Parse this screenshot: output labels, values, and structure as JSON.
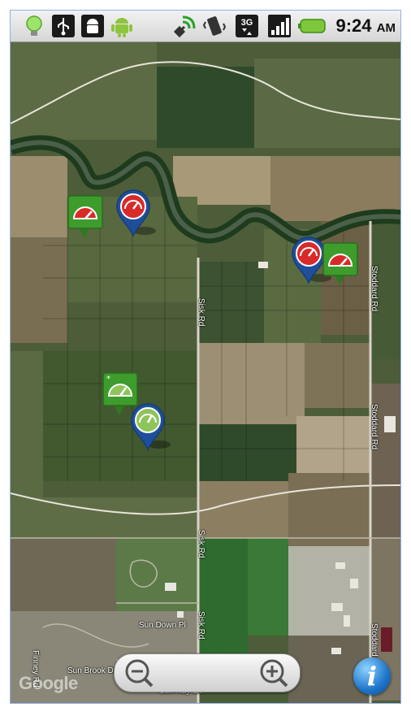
{
  "status_bar": {
    "icons": [
      "bulb-icon",
      "usb-icon",
      "android-debug-icon",
      "android-icon",
      "gps-icon",
      "vibrate-icon",
      "3g-data-icon",
      "signal-icon",
      "battery-icon"
    ],
    "time": "9:24",
    "ampm": "AM"
  },
  "map": {
    "road_labels": {
      "sisk_rd_top": "Sisk Rd",
      "sisk_rd_bottom": "Sisk Rd",
      "sisk_rd_lower": "Sisk Rd",
      "stoddard_rd_top": "Stoddard Rd",
      "stoddard_rd_middle": "Stoddard Rd",
      "stoddard_rd_bottom": "Stoddard Rd",
      "sun_down_pl": "Sun Down Pl",
      "sun_brook_dr": "Sun Brook Dr",
      "sun_ray_ln": "Sun Ray Ln",
      "finney_rd": "Finney Rd"
    },
    "google_logo": "Google",
    "markers": [
      {
        "kind": "square",
        "color": "#3d9c2c",
        "gauge": "red"
      },
      {
        "kind": "pin",
        "color": "#1f4f9a",
        "gauge": "red"
      },
      {
        "kind": "pin",
        "color": "#1f4f9a",
        "gauge": "red"
      },
      {
        "kind": "square",
        "color": "#3d9c2c",
        "gauge": "red"
      },
      {
        "kind": "square",
        "color": "#3d9c2c",
        "gauge": "green"
      },
      {
        "kind": "pin",
        "color": "#1f4f9a",
        "gauge": "green"
      }
    ]
  },
  "controls": {
    "zoom_out": "zoom-out-icon",
    "zoom_in": "zoom-in-icon",
    "info_label": "i"
  }
}
